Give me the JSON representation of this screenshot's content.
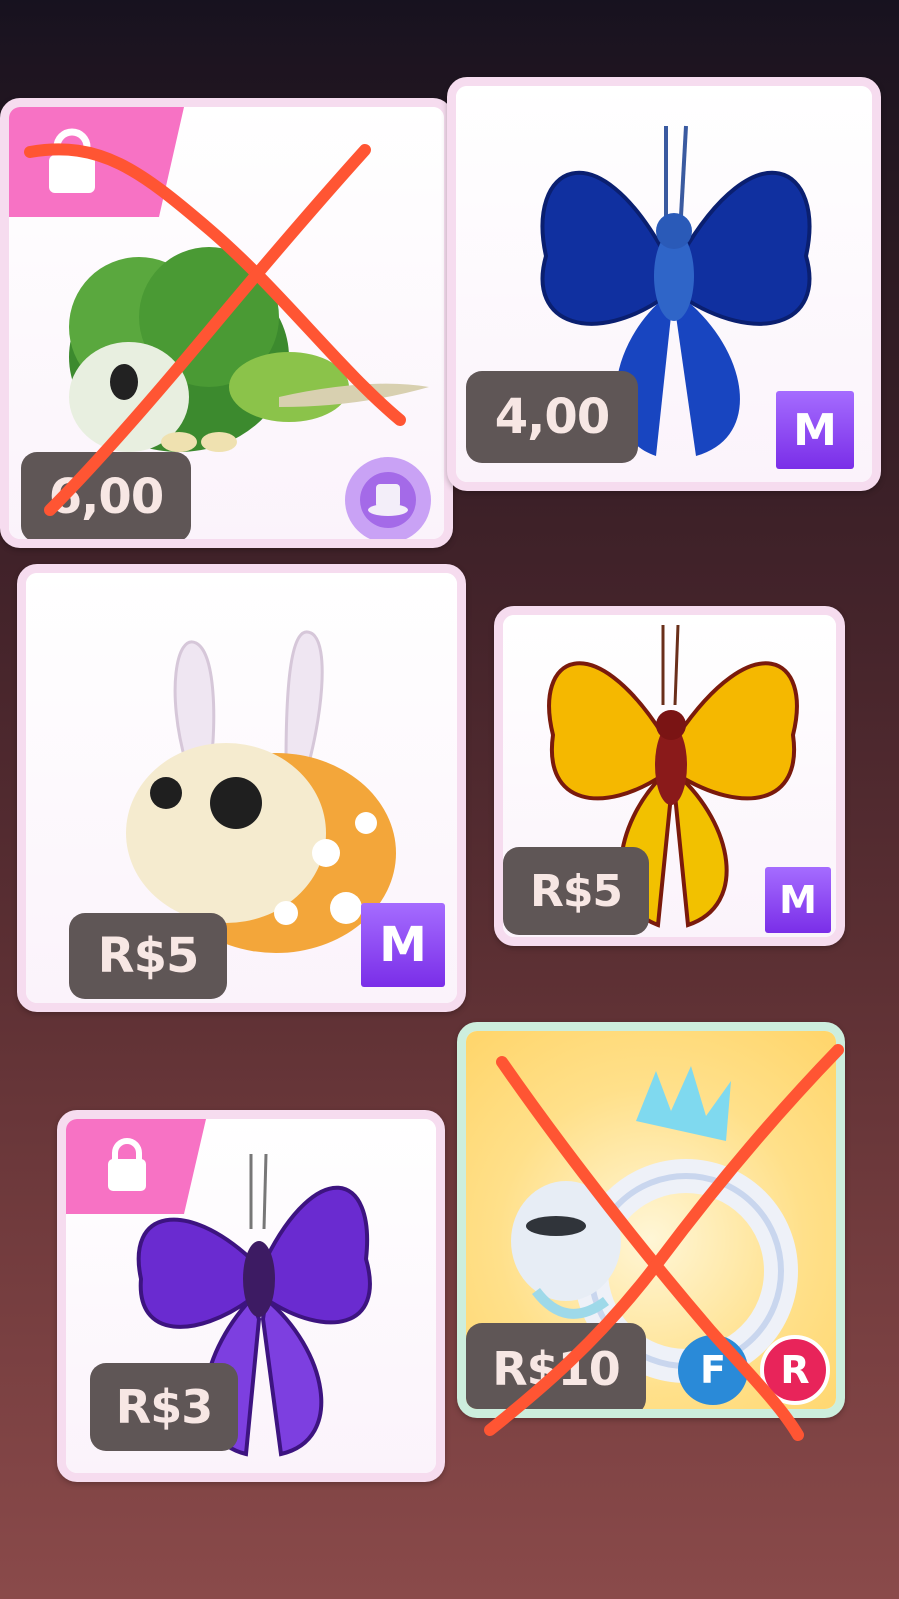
{
  "items": [
    {
      "name": "card-leaf-pet",
      "price": "6,00",
      "badge": "hat-icon",
      "crossed": true,
      "locked": true
    },
    {
      "name": "card-blue-butterfly",
      "price": "4,00",
      "badge": "M",
      "crossed": false,
      "locked": false
    },
    {
      "name": "card-bunny-ladybug",
      "price": "R$5",
      "badge": "M",
      "crossed": false,
      "locked": false
    },
    {
      "name": "card-gold-butterfly",
      "price": "R$5",
      "badge": "M",
      "crossed": false,
      "locked": false
    },
    {
      "name": "card-purple-butterfly",
      "price": "R$3",
      "badge": "",
      "crossed": false,
      "locked": true
    },
    {
      "name": "card-neon-dragon",
      "price": "R$10",
      "badges": [
        "F",
        "R"
      ],
      "crossed": true,
      "locked": false
    }
  ],
  "colors": {
    "cross": "#ff5533",
    "price_bg": "#5f5656",
    "mega": "#8b3cf0",
    "lock": "#f772c4"
  }
}
